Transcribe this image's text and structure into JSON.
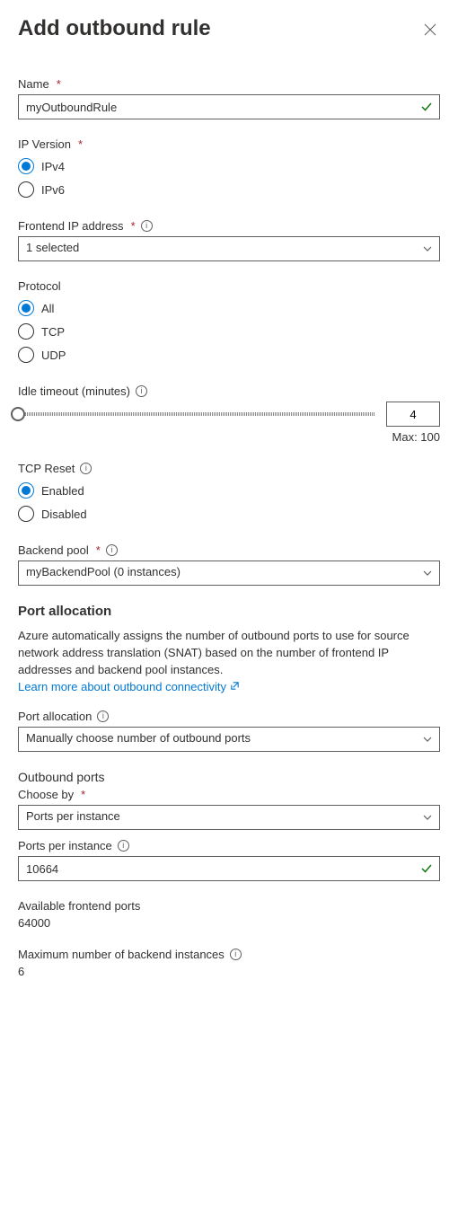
{
  "header": {
    "title": "Add outbound rule"
  },
  "name": {
    "label": "Name",
    "value": "myOutboundRule"
  },
  "ip_version": {
    "label": "IP Version",
    "options": [
      "IPv4",
      "IPv6"
    ],
    "selected": "IPv4"
  },
  "frontend_ip": {
    "label": "Frontend IP address",
    "value": "1 selected"
  },
  "protocol": {
    "label": "Protocol",
    "options": [
      "All",
      "TCP",
      "UDP"
    ],
    "selected": "All"
  },
  "idle_timeout": {
    "label": "Idle timeout (minutes)",
    "value": "4",
    "max_label": "Max: 100"
  },
  "tcp_reset": {
    "label": "TCP Reset",
    "options": [
      "Enabled",
      "Disabled"
    ],
    "selected": "Enabled"
  },
  "backend_pool": {
    "label": "Backend pool",
    "value": "myBackendPool (0 instances)"
  },
  "port_allocation_section": {
    "heading": "Port allocation",
    "description": "Azure automatically assigns the number of outbound ports to use for source network address translation (SNAT) based on the number of frontend IP addresses and backend pool instances.",
    "link_text": "Learn more about outbound connectivity"
  },
  "port_allocation": {
    "label": "Port allocation",
    "value": "Manually choose number of outbound ports"
  },
  "outbound_ports": {
    "heading": "Outbound ports",
    "choose_by_label": "Choose by",
    "choose_by_value": "Ports per instance"
  },
  "ports_per_instance": {
    "label": "Ports per instance",
    "value": "10664"
  },
  "available_ports": {
    "label": "Available frontend ports",
    "value": "64000"
  },
  "max_backend": {
    "label": "Maximum number of backend instances",
    "value": "6"
  }
}
